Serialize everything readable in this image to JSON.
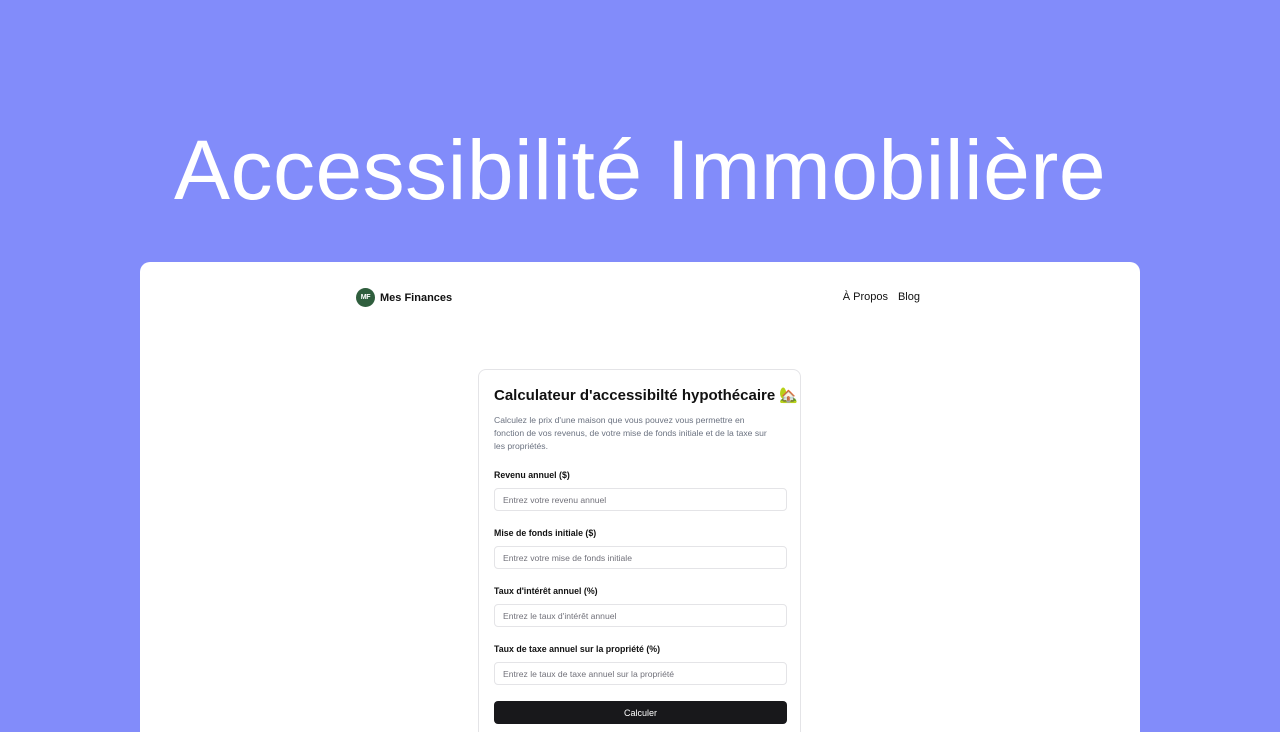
{
  "hero": {
    "title": "Accessibilité Immobilière"
  },
  "site": {
    "logo_initials": "MF",
    "logo_name": "Mes Finances",
    "nav": [
      "À Propos",
      "Blog"
    ]
  },
  "calculator": {
    "title": "Calculateur d'accessibilté hypothécaire 🏡",
    "description": "Calculez le prix d'une maison que vous pouvez vous permettre en fonction de vos revenus, de votre mise de fonds initiale et de la taxe sur les propriétés.",
    "fields": [
      {
        "label": "Revenu annuel ($)",
        "placeholder": "Entrez votre revenu annuel",
        "value": ""
      },
      {
        "label": "Mise de fonds initiale ($)",
        "placeholder": "Entrez votre mise de fonds initiale",
        "value": ""
      },
      {
        "label": "Taux d'intérêt annuel (%)",
        "placeholder": "Entrez le taux d'intérêt annuel",
        "value": ""
      },
      {
        "label": "Taux de taxe annuel sur la propriété (%)",
        "placeholder": "Entrez le taux de taxe annuel sur la propriété",
        "value": ""
      }
    ],
    "submit_label": "Calculer"
  },
  "colors": {
    "background": "#828cfa",
    "logo_badge": "#2f5e3d",
    "button": "#18181b"
  }
}
